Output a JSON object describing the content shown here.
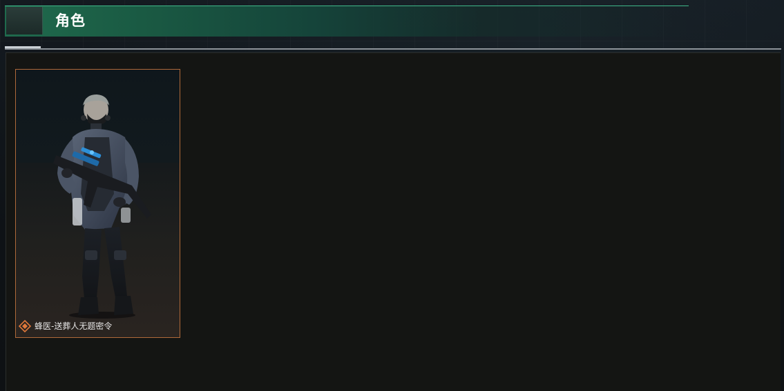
{
  "header": {
    "title": "角色"
  },
  "characters": [
    {
      "name": "蜂医-送葬人无题密令",
      "rarity_icon": "diamond-rarity-icon",
      "rarity_color": "#e0783a",
      "selected": true
    }
  ],
  "colors": {
    "header_accent": "#1f6a4d",
    "card_border": "#b06a3a",
    "panel_bg": "#141513"
  }
}
